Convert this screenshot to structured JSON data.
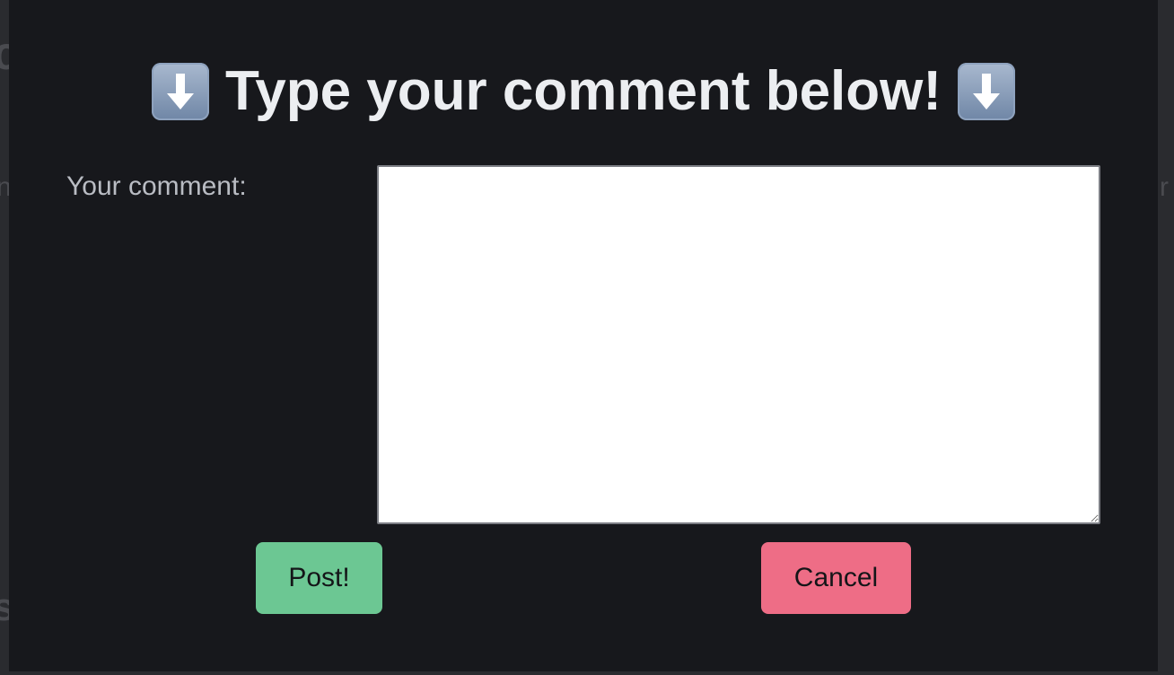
{
  "background": {
    "fragments": [
      "c",
      "n",
      "s",
      "r"
    ]
  },
  "dialog": {
    "title": "Type your comment below!",
    "title_icon_left": "down-arrow-icon",
    "title_icon_right": "down-arrow-icon",
    "comment_label": "Your comment:",
    "comment_value": "",
    "post_label": "Post!",
    "cancel_label": "Cancel"
  },
  "colors": {
    "modal_background": "#17181c",
    "post_button": "#6cc793",
    "cancel_button": "#ee6d86",
    "title_text": "#eceef1"
  }
}
